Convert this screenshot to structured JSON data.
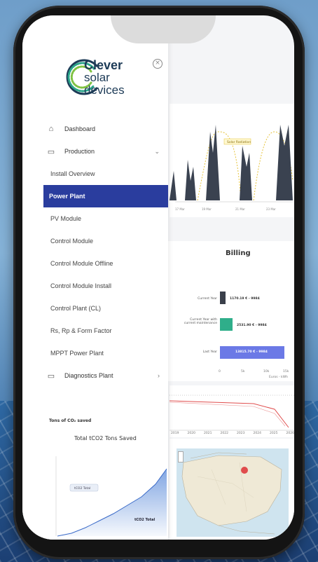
{
  "brand": {
    "line1": "Clever",
    "line2": "solar",
    "line3": "devices",
    "accent": "#2a3d9e"
  },
  "sidebar": {
    "close_icon": "close-circle-icon",
    "items": [
      {
        "label": "Dashboard",
        "icon": "home-icon"
      },
      {
        "label": "Production",
        "icon": "monitor-icon",
        "expanded": true
      },
      {
        "label": "Install Overview"
      },
      {
        "label": "Power Plant",
        "active": true
      },
      {
        "label": "PV Module"
      },
      {
        "label": "Control Module"
      },
      {
        "label": "Control Module Offline"
      },
      {
        "label": "Control Module Install"
      },
      {
        "label": "Control Plant (CL)"
      },
      {
        "label": "Rs, Rp & Form Factor"
      },
      {
        "label": "MPPT Power Plant"
      },
      {
        "label": "Diagnostics Plant",
        "icon": "monitor-icon"
      }
    ]
  },
  "co2": {
    "section_title": "Tons of CO₂ saved",
    "chart_title": "Total tCO2 Tons Saved",
    "legend": "tCO2 Total",
    "annotation": "tCO2 Total"
  },
  "production_chart": {
    "legend_label": "Solar Radiation",
    "x_ticks": [
      "17 Mar",
      "19 Mar",
      "21 Mar",
      "23 Mar"
    ]
  },
  "billing": {
    "title": "Billing",
    "rows": [
      {
        "label": "Current Year",
        "value_text": "1170.19 € - 9984",
        "color": "#3a3f4a",
        "value": 0.1
      },
      {
        "label": "Current Year with current maintenance",
        "value_text": "2531.90 € - 9984",
        "color": "#2fae8a",
        "value": 0.18
      },
      {
        "label": "Last Year",
        "value_text": "13815.70 € - 9984",
        "color": "#6b79e6",
        "value": 1.0
      }
    ],
    "x_ticks": [
      "0",
      "5k",
      "10k",
      "15k"
    ],
    "x_caption": "Euros - kWh"
  },
  "loss_chart": {
    "x_ticks": [
      "2019",
      "2020",
      "2021",
      "2022",
      "2023",
      "2024",
      "2025",
      "2026"
    ]
  },
  "map": {
    "marker_color": "#e04c4c"
  }
}
